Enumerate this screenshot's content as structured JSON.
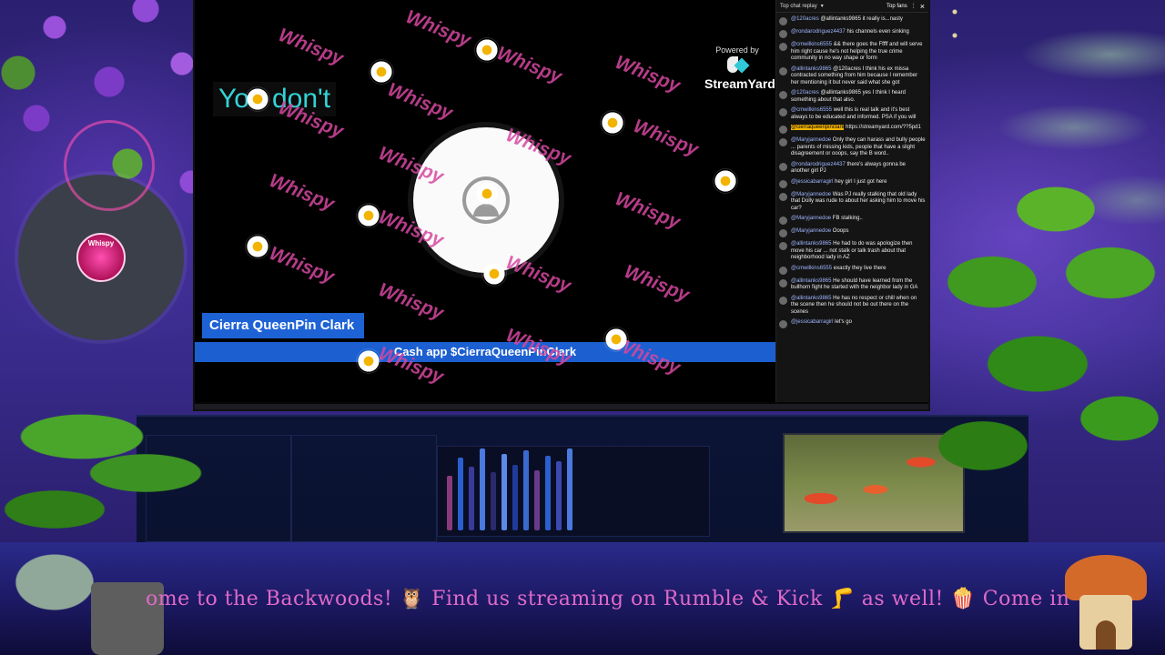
{
  "stage": {
    "caption": "You don't",
    "name_tag": "Cierra QueenPin Clark",
    "cash_bar": "Cash app $CierraQueenPinClark",
    "brand_powered": "Powered by",
    "brand_name": "StreamYard",
    "watermark": "Whispy"
  },
  "chat": {
    "header_mode": "Top chat replay",
    "header_tab": "Top fans",
    "close_icon": "×",
    "messages": [
      {
        "user": "@120acres",
        "text": "@allintanks9865 it really is...nasty"
      },
      {
        "user": "@rondarodriguez4437",
        "text": "his channels even sinking"
      },
      {
        "user": "@cmwilkins6555",
        "text": "&& there goes the Fffff and will serve him right cause he's not helping the true crime community in no way shape or form"
      },
      {
        "user": "@allintanks9865",
        "text": "@120acres I think his ex missa contracted something from him because I remember her mentioning it but never said what she got"
      },
      {
        "user": "@120acres",
        "text": "@allintanks9865 yes I think I heard something about that also."
      },
      {
        "user": "@cmwilkins6555",
        "text": "well this is real talk and it's best always to be educated and informed. PSA if you will"
      },
      {
        "user": "@cierraqueenpinclark",
        "text": "https://streamyard.com/??5pd1",
        "highlight": true
      },
      {
        "user": "@Maryjannedoe",
        "text": "Only they can harass and bully people ... parents of missing kids, people that have a slight disagreement or ooops, say the B word.."
      },
      {
        "user": "@rondarodriguez4437",
        "text": "there's always gonna be another girl PJ"
      },
      {
        "user": "@jessicabarragirl",
        "text": "hey girl I just got here"
      },
      {
        "user": "@Maryjannedoe",
        "text": "Was PJ really stalking that old lady that Dolly was rude to about her asking him to move his car?"
      },
      {
        "user": "@Maryjannedoe",
        "text": "FB stalking.."
      },
      {
        "user": "@Maryjannedoe",
        "text": "Ooops"
      },
      {
        "user": "@allintanks9865",
        "text": "He had to do was apologize then move his car ... not stalk or talk trash about that neighborhood lady in AZ"
      },
      {
        "user": "@cmwilkins6555",
        "text": "exactly they live there"
      },
      {
        "user": "@allintanks9865",
        "text": "He should have learned from the bullhorn fight he started with the neighbor lady in GA"
      },
      {
        "user": "@allintanks9865",
        "text": "He has no respect or chill when on the scene then he should not be out there on the scenes"
      },
      {
        "user": "@jessicabarragirl",
        "text": "let's go"
      }
    ]
  },
  "overlay": {
    "badge": "Whispy",
    "ticker": "ome to the Backwoods! 🦉 Find us streaming on Rumble & Kick 🦵 as well! 🍿 Come in"
  },
  "colors": {
    "accent_blue": "#1e63d6",
    "watermark_pink": "#d646a0",
    "caption_cyan": "#34d3d6",
    "ticker_pink": "#e06ac8"
  }
}
